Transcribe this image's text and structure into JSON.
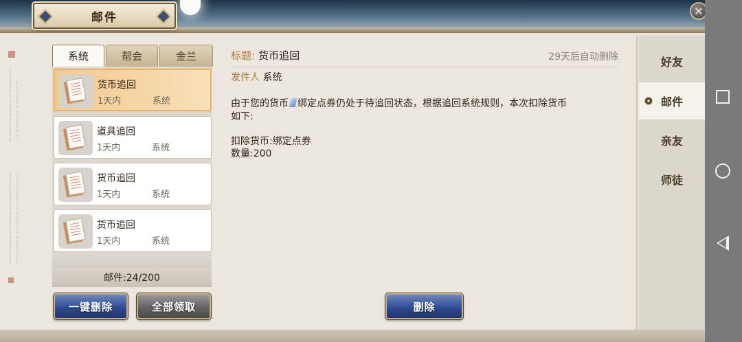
{
  "window": {
    "title": "邮件",
    "close_icon": "close-icon"
  },
  "tabs": [
    {
      "label": "系统",
      "active": true
    },
    {
      "label": "帮会",
      "active": false
    },
    {
      "label": "金兰",
      "active": false
    }
  ],
  "mail_list": {
    "items": [
      {
        "title": "货币追回",
        "time": "1天内",
        "sender": "系统",
        "selected": true
      },
      {
        "title": "道具追回",
        "time": "1天内",
        "sender": "系统",
        "selected": false
      },
      {
        "title": "货币追回",
        "time": "1天内",
        "sender": "系统",
        "selected": false
      },
      {
        "title": "货币追回",
        "time": "1天内",
        "sender": "系统",
        "selected": false
      }
    ],
    "count_label": "邮件:24/200"
  },
  "buttons": {
    "delete_all": "一键删除",
    "claim_all": "全部领取",
    "delete": "删除"
  },
  "detail": {
    "title_key": "标题:",
    "title_value": "货币追回",
    "auto_delete": "29天后自动删除",
    "sender_key": "发件人",
    "sender_value": "系统",
    "body_part1": "由于您的货币",
    "body_part2": "绑定点券仍处于待追回状态，根据追回系统规则，本次扣除货币",
    "body_line2": "如下:",
    "deduct_line": "扣除货币:绑定点券",
    "amount_line": "数量:200"
  },
  "side_nav": [
    {
      "label": "好友",
      "active": false
    },
    {
      "label": "邮件",
      "active": true
    },
    {
      "label": "亲友",
      "active": false
    },
    {
      "label": "师徒",
      "active": false
    }
  ],
  "android_nav": {
    "recents": "square-icon",
    "home": "circle-icon",
    "back": "back-triangle-icon"
  }
}
